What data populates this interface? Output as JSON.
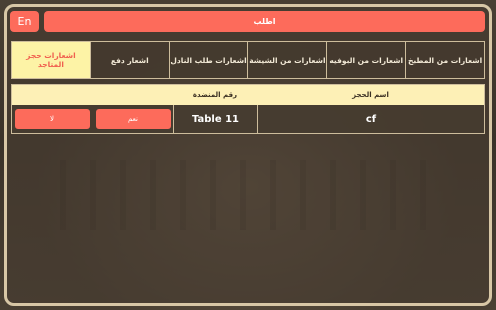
{
  "lang_button": "En",
  "title": "اطلب",
  "tabs": [
    {
      "label": "اشعارات حجز المتاجد",
      "active": true
    },
    {
      "label": "اشعار دفع",
      "active": false
    },
    {
      "label": "اشعارات طلب النادل",
      "active": false
    },
    {
      "label": "اشعارات من الشيشة",
      "active": false
    },
    {
      "label": "اشعارات من البوفيه",
      "active": false
    },
    {
      "label": "اشعارات من المطبخ",
      "active": false
    }
  ],
  "table": {
    "headers": {
      "table_number": "رقم المنضدة",
      "booking_name": "اسم الحجز"
    },
    "rows": [
      {
        "no_label": "لا",
        "yes_label": "نعم",
        "table_number": "Table 11",
        "booking_name": "cf"
      }
    ]
  },
  "colors": {
    "accent": "#fd6b5b",
    "active_tab": "#fdf3a6",
    "header": "#fdf0b6",
    "border": "#d8c7a6"
  }
}
